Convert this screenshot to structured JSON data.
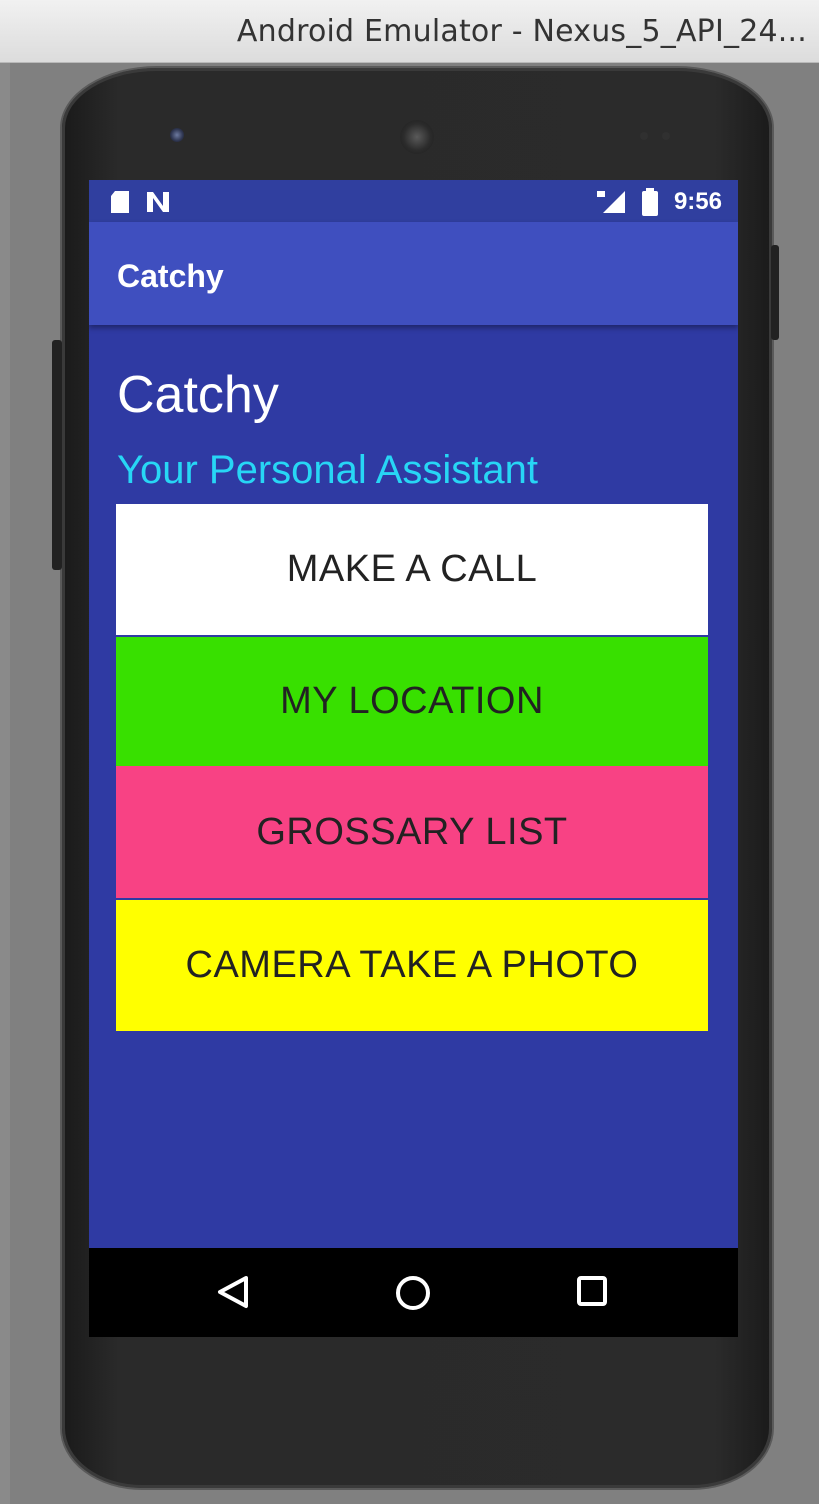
{
  "window": {
    "title": "Android Emulator - Nexus_5_API_24..."
  },
  "statusbar": {
    "time": "9:56",
    "left_icons": [
      "sd-card-icon",
      "n-notification-icon"
    ],
    "right_icons": [
      "lte-signal-icon",
      "battery-icon"
    ]
  },
  "appbar": {
    "title": "Catchy"
  },
  "content": {
    "heading": "Catchy",
    "subheading": "Your Personal Assistant",
    "buttons": [
      {
        "label": "MAKE A CALL",
        "color": "#ffffff"
      },
      {
        "label": "MY LOCATION",
        "color": "#38e000"
      },
      {
        "label": "GROSSARY LIST",
        "color": "#f84284"
      },
      {
        "label": "CAMERA TAKE A PHOTO",
        "color": "#ffff00"
      }
    ]
  },
  "navbar": {
    "icons": [
      "back-icon",
      "home-icon",
      "recents-icon"
    ]
  },
  "colors": {
    "screen_bg": "#2f3aa3",
    "appbar": "#3f4fbf",
    "statusbar": "#303f9f",
    "subheading": "#27d6f5"
  }
}
